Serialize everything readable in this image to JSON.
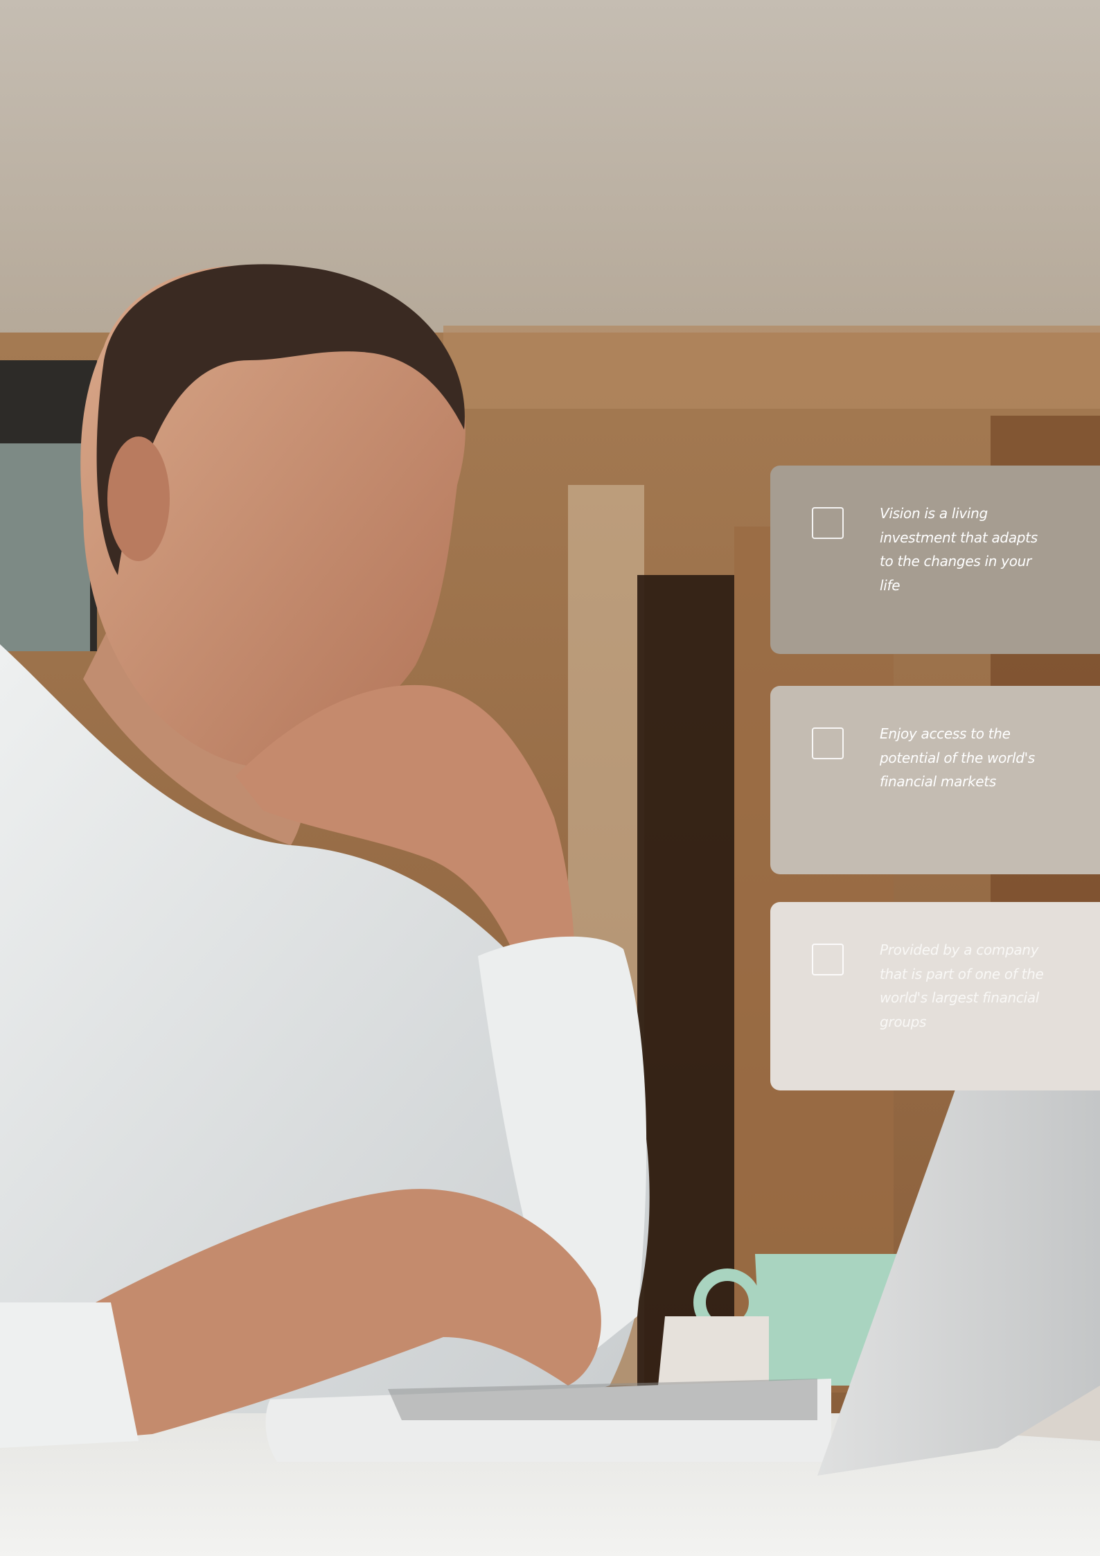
{
  "page": {
    "background_colors": {
      "ceiling": "#c3bbb0",
      "wood_wall": "#93663f",
      "desk": "#f0f0ee"
    },
    "photo_description_icon": "man-at-laptop-photo"
  },
  "callouts": [
    {
      "icon": "checkbox-icon",
      "text": "Vision is a living investment that adapts to the changes in your life",
      "color": "#a69d91"
    },
    {
      "icon": "checkbox-icon",
      "text": "Enjoy access to the potential of the world's financial markets",
      "color": "#c4bcb2"
    },
    {
      "icon": "checkbox-icon",
      "text": "Provided by a company that is part of one of the world's largest financial groups",
      "color": "#e4dfda"
    }
  ]
}
